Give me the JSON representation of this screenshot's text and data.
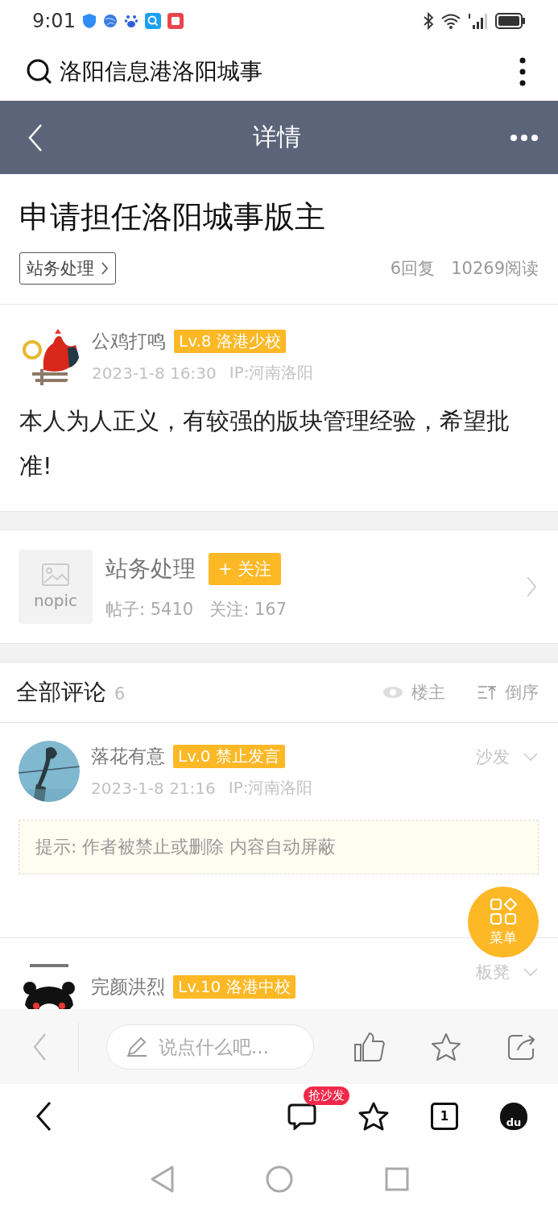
{
  "status_bar": {
    "time": "9:01"
  },
  "search_bar": {
    "query": "洛阳信息港洛阳城事"
  },
  "nav": {
    "title": "详情"
  },
  "thread": {
    "title": "申请担任洛阳城事版主",
    "forum_tag": "站务处理",
    "replies": "6回复",
    "views": "10269阅读"
  },
  "post": {
    "author": "公鸡打鸣",
    "level": "Lv.8 洛港少校",
    "time": "2023-1-8 16:30",
    "ip": "IP:河南洛阳",
    "body": "本人为人正义，有较强的版块管理经验，希望批准!"
  },
  "forum_card": {
    "thumb_text": "nopic",
    "name": "站务处理",
    "follow": "+ 关注",
    "posts": "帖子: 5410",
    "followers": "关注: 167"
  },
  "comments_header": {
    "title": "全部评论",
    "count": "6",
    "filters": [
      {
        "label": "楼主",
        "kind": "eye"
      },
      {
        "label": "倒序",
        "kind": "sort"
      }
    ]
  },
  "comments": [
    {
      "author": "落花有意",
      "level": "Lv.0 禁止发言",
      "time": "2023-1-8 21:16",
      "ip": "IP:河南洛阳",
      "floor": "沙发",
      "notice": "提示: 作者被禁止或删除 内容自动屏蔽"
    },
    {
      "author": "完颜洪烈",
      "level": "Lv.10 洛港中校",
      "floor": "板凳"
    }
  ],
  "fab": {
    "label": "菜单"
  },
  "toolbar": {
    "placeholder": "说点什么吧..."
  },
  "browser_bar": {
    "badge": "抢沙发",
    "tab_count": "1",
    "logo_text": "du"
  }
}
